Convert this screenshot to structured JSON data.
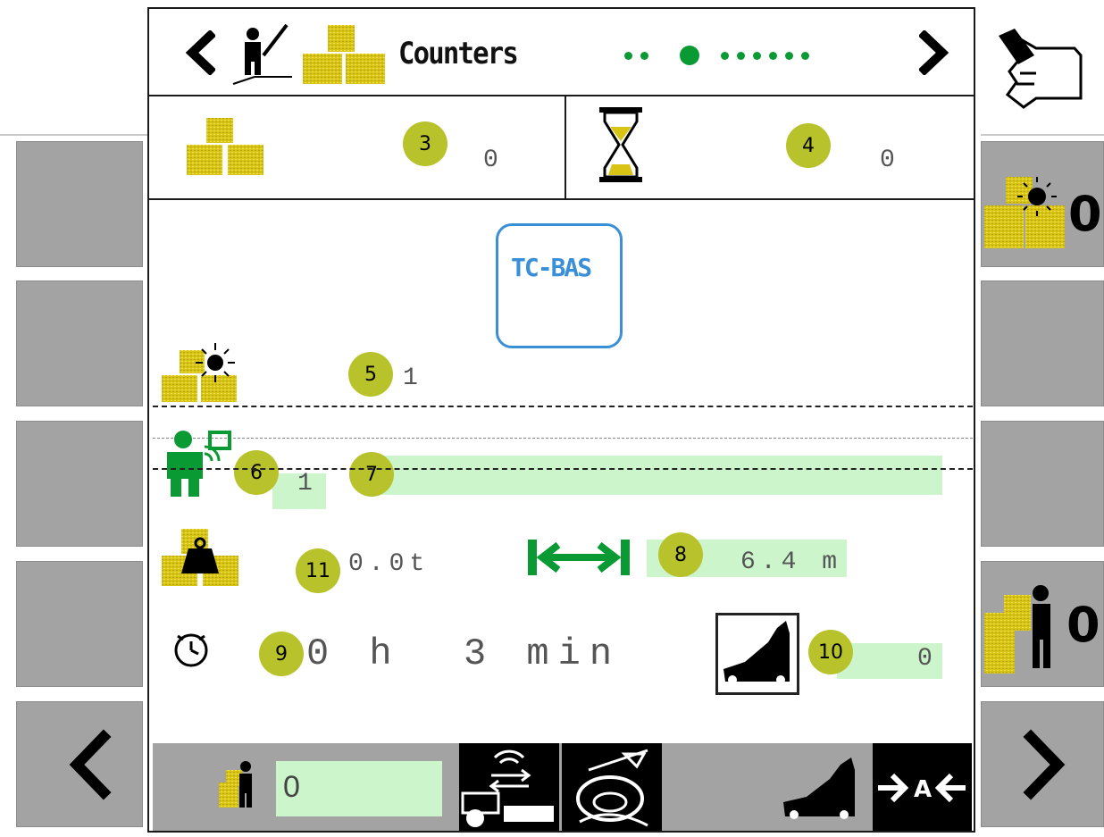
{
  "header": {
    "title": "Counters",
    "page_dots_total": 9,
    "page_dots_active_index": 2
  },
  "counters": {
    "bales_value": "0",
    "time_value": "0"
  },
  "tc_badge": {
    "label": "TC-BAS"
  },
  "rows": {
    "new_bales_value": "1",
    "operator_value": "1",
    "operator_name": "",
    "weight_value": "0.0t",
    "width_value": "6.4 m",
    "time_value": "0 h  3 min",
    "pickup_value": "0"
  },
  "callouts": {
    "c3": "3",
    "c4": "4",
    "c5": "5",
    "c6": "6",
    "c7": "7",
    "c8": "8",
    "c9": "9",
    "c10": "10",
    "c11": "11"
  },
  "right_softkeys": {
    "reset_bales_value": "0",
    "reset_operator_value": "0"
  },
  "footer": {
    "operator_bales_value": "0"
  },
  "colors": {
    "bale": "#d8c414",
    "accent_green": "#0a9a34",
    "field_green": "#ccf5cc",
    "callout": "#b8c22b",
    "tc_blue": "#3a8fd6",
    "softkey_gray": "#a3a3a3"
  },
  "icons": {
    "prev": "chevron-left-icon",
    "next": "chevron-right-icon",
    "operator_bale": "operator-bale-icon",
    "hourglass": "hourglass-icon",
    "clock": "clock-icon",
    "weight": "weight-icon",
    "width": "width-arrows-icon",
    "pickup": "pickup-icon",
    "hand": "hand-pointer-icon"
  }
}
